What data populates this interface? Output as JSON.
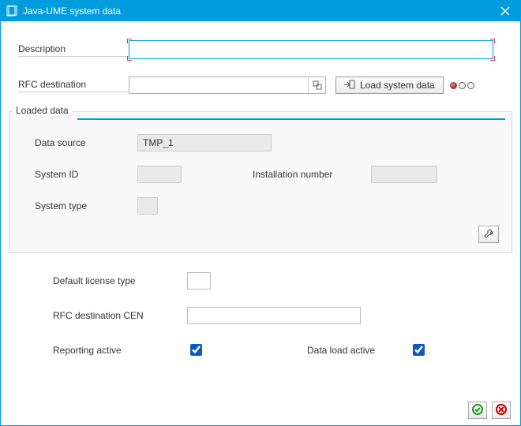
{
  "titlebar": {
    "title": "Java-UME system data"
  },
  "form": {
    "description_label": "Description",
    "description_value": "",
    "rfc_label": "RFC destination",
    "rfc_value": "",
    "load_button": "Load system data"
  },
  "groupbox": {
    "title": "Loaded data",
    "data_source_label": "Data source",
    "data_source_value": "TMP_1",
    "system_id_label": "System ID",
    "system_id_value": "",
    "installation_label": "Installation number",
    "installation_value": "",
    "system_type_label": "System type",
    "system_type_value": ""
  },
  "bottom": {
    "license_label": "Default license type",
    "license_value": "",
    "rfc_cen_label": "RFC destination CEN",
    "rfc_cen_value": "",
    "reporting_label": "Reporting active",
    "dataload_label": "Data load active"
  }
}
